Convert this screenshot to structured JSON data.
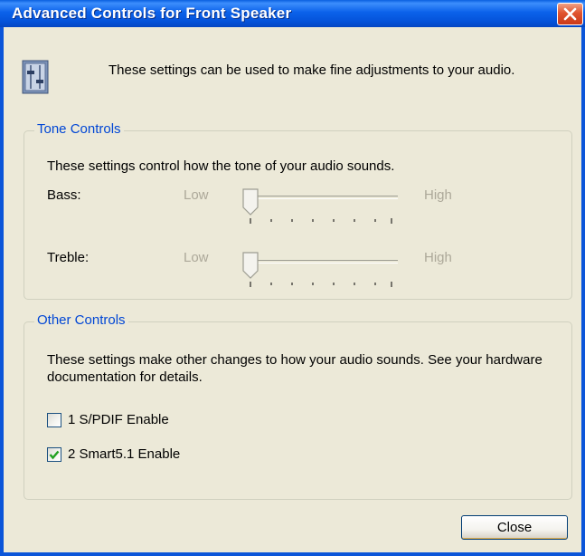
{
  "window": {
    "title": "Advanced Controls for Front Speaker",
    "close_icon": "close-icon"
  },
  "intro": {
    "text": "These settings can be used to make fine adjustments to your audio.",
    "icon": "mixer-settings-icon"
  },
  "tone": {
    "legend": "Tone Controls",
    "description": "These settings control how the tone of your audio sounds.",
    "bass": {
      "label": "Bass:",
      "low": "Low",
      "high": "High",
      "level": 0.0
    },
    "treble": {
      "label": "Treble:",
      "low": "Low",
      "high": "High",
      "level": 0.0
    }
  },
  "other": {
    "legend": "Other Controls",
    "description": "These settings make other changes to how your audio sounds.  See your hardware documentation for details.",
    "checkboxes": [
      {
        "label": "1  S/PDIF Enable",
        "checked": false
      },
      {
        "label": "2  Smart5.1 Enable",
        "checked": true
      }
    ]
  },
  "buttons": {
    "close": "Close"
  },
  "colors": {
    "titlebar": "#0b62ea",
    "group_legend": "#0046d5",
    "check": "#21a121",
    "close_button": "#e0542f"
  }
}
